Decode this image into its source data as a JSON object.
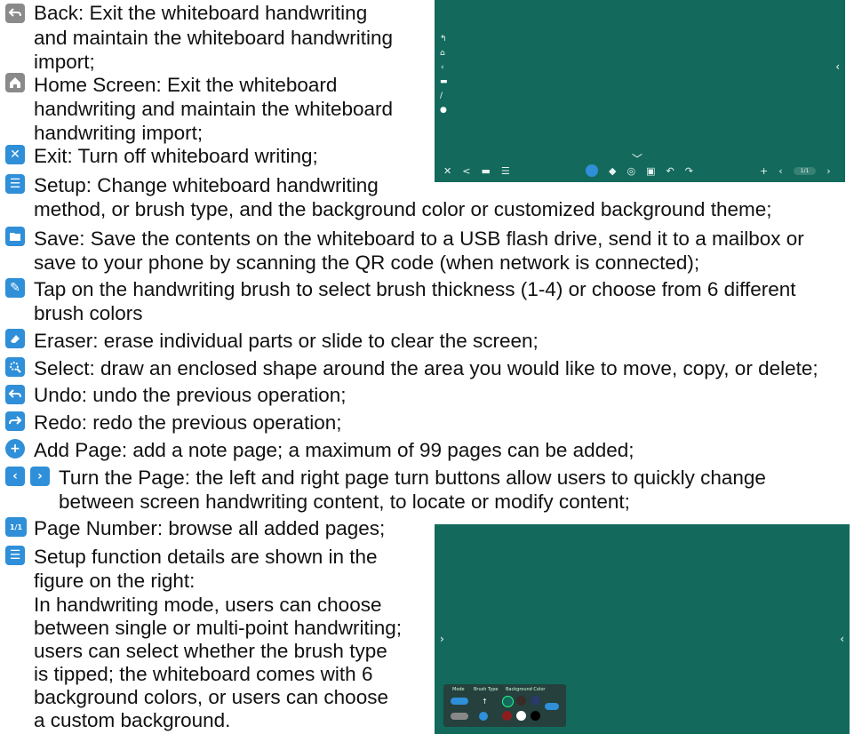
{
  "items": [
    {
      "icon": "back-icon",
      "lines": [
        "Back: Exit the whiteboard handwriting",
        "and maintain the whiteboard handwriting",
        "import;"
      ]
    },
    {
      "icon": "home-icon",
      "lines": [
        "Home Screen: Exit the whiteboard",
        "handwriting and maintain the whiteboard",
        "handwriting import;"
      ]
    },
    {
      "icon": "exit-icon",
      "lines": [
        "Exit: Turn off whiteboard writing;"
      ]
    },
    {
      "icon": "setup-icon",
      "lines": [
        "Setup: Change whiteboard handwriting",
        "method, or brush type, and the background color or customized background theme;"
      ]
    },
    {
      "icon": "save-icon",
      "lines": [
        "Save: Save the contents on the whiteboard to a USB flash drive, send it to a mailbox or",
        "save to your phone by scanning the QR code (when network is connected);"
      ]
    },
    {
      "icon": "brush-icon",
      "lines": [
        "Tap on the handwriting brush to select brush thickness (1-4) or choose from 6 different",
        "brush colors"
      ]
    },
    {
      "icon": "eraser-icon",
      "lines": [
        "Eraser: erase individual parts or slide to clear the screen;"
      ]
    },
    {
      "icon": "select-icon",
      "lines": [
        "Select: draw an enclosed shape around the area you would like to move, copy, or delete;"
      ]
    },
    {
      "icon": "undo-icon",
      "lines": [
        "Undo: undo the previous operation;"
      ]
    },
    {
      "icon": "redo-icon",
      "lines": [
        "Redo: redo the previous operation;"
      ]
    },
    {
      "icon": "add-page-icon",
      "lines": [
        "Add Page: add a note page; a maximum of 99 pages can be added;"
      ]
    },
    {
      "icon": "turn-page-icons",
      "lines": [
        "Turn the Page: the left and right page turn buttons allow users to quickly change",
        "between screen handwriting content, to locate or modify content;"
      ]
    },
    {
      "icon": "page-number-icon",
      "lines": [
        "Page Number: browse all added pages;"
      ]
    },
    {
      "icon": "setup-icon",
      "lines": [
        "Setup function details are shown in the",
        "figure on the right:",
        "In handwriting mode, users can choose",
        "between single or multi-point handwriting;",
        "users can select whether the brush type",
        "is tipped; the whiteboard comes with 6",
        "background colors, or users can choose",
        "a custom background."
      ]
    }
  ],
  "page_number_badge": "1/1",
  "board_bottom": {
    "panel_headers": [
      "Mode",
      "Brush Type",
      "Background Color"
    ],
    "background_colors": [
      "#136a5c",
      "#3a2a2a",
      "#2a3a6a",
      "#8a1e1e",
      "#ffffff",
      "#000000"
    ]
  },
  "board_top": {
    "page_indicator": "1/1"
  }
}
